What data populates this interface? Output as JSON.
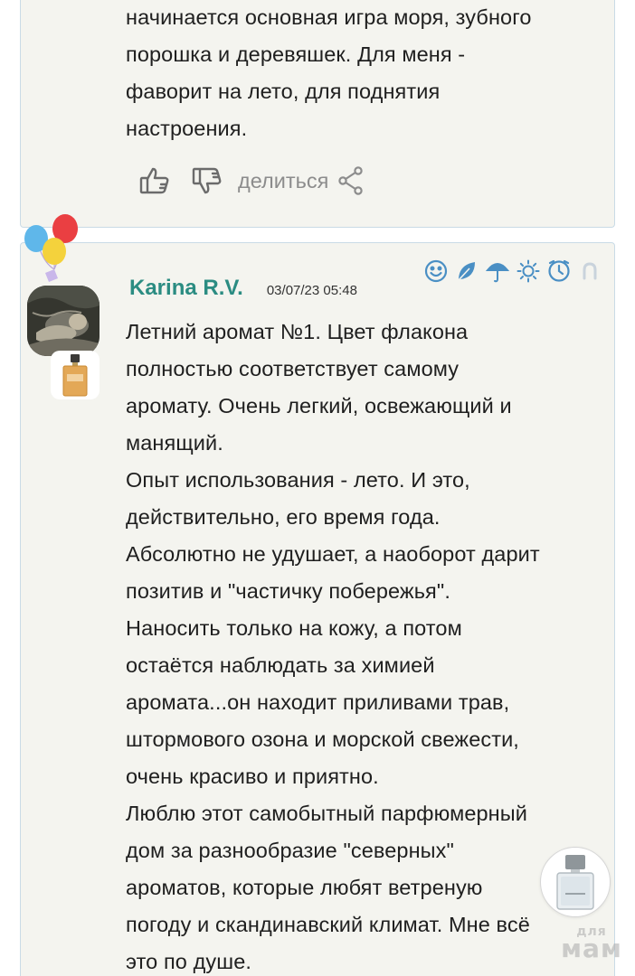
{
  "previous_comment": {
    "text": "начинается основная игра моря, зубного\nпорошка и деревяшек. Для меня -\nфаворит на лето, для поднятия\nнастроения.",
    "actions": {
      "like_icon": "thumbs-up-icon",
      "dislike_icon": "thumbs-down-icon",
      "share_label": "делиться",
      "share_icon": "share-icon"
    }
  },
  "comment": {
    "author": "Karina R.V.",
    "date": "03/07/23 05:48",
    "badges": [
      "smile-icon",
      "leaf-icon",
      "umbrella-icon",
      "sun-icon",
      "clock-icon",
      "horseshoe-icon"
    ],
    "text": "Летний аромат №1. Цвет флакона\nполностью соответствует самому\nаромату. Очень легкий, освежающий и\nманящий.\nОпыт использования - лето. И это,\nдействительно, его время года.\nАбсолютно не удушает, а наоборот дарит\nпозитив и \"частичку побережья\".\nНаносить только на кожу, а потом\nостаётся наблюдать за химией\nаромата...он находит приливами трав,\nштормового озона и морской свежести,\nочень красиво и приятно.\nЛюблю этот самобытный парфюмерный\nдом за разнообразие \"северных\"\nароматов, которые любят ветреную\nпогоду и скандинавский климат. Мне всё\nэто по душе."
  },
  "watermark": {
    "top": "для",
    "main": "мам"
  },
  "colors": {
    "card_background": "#f4f4ef",
    "card_border": "#c9dbe6",
    "author": "#2b8c82",
    "icon_blue": "#4a8fc4",
    "action_gray": "#8c8c8c"
  }
}
